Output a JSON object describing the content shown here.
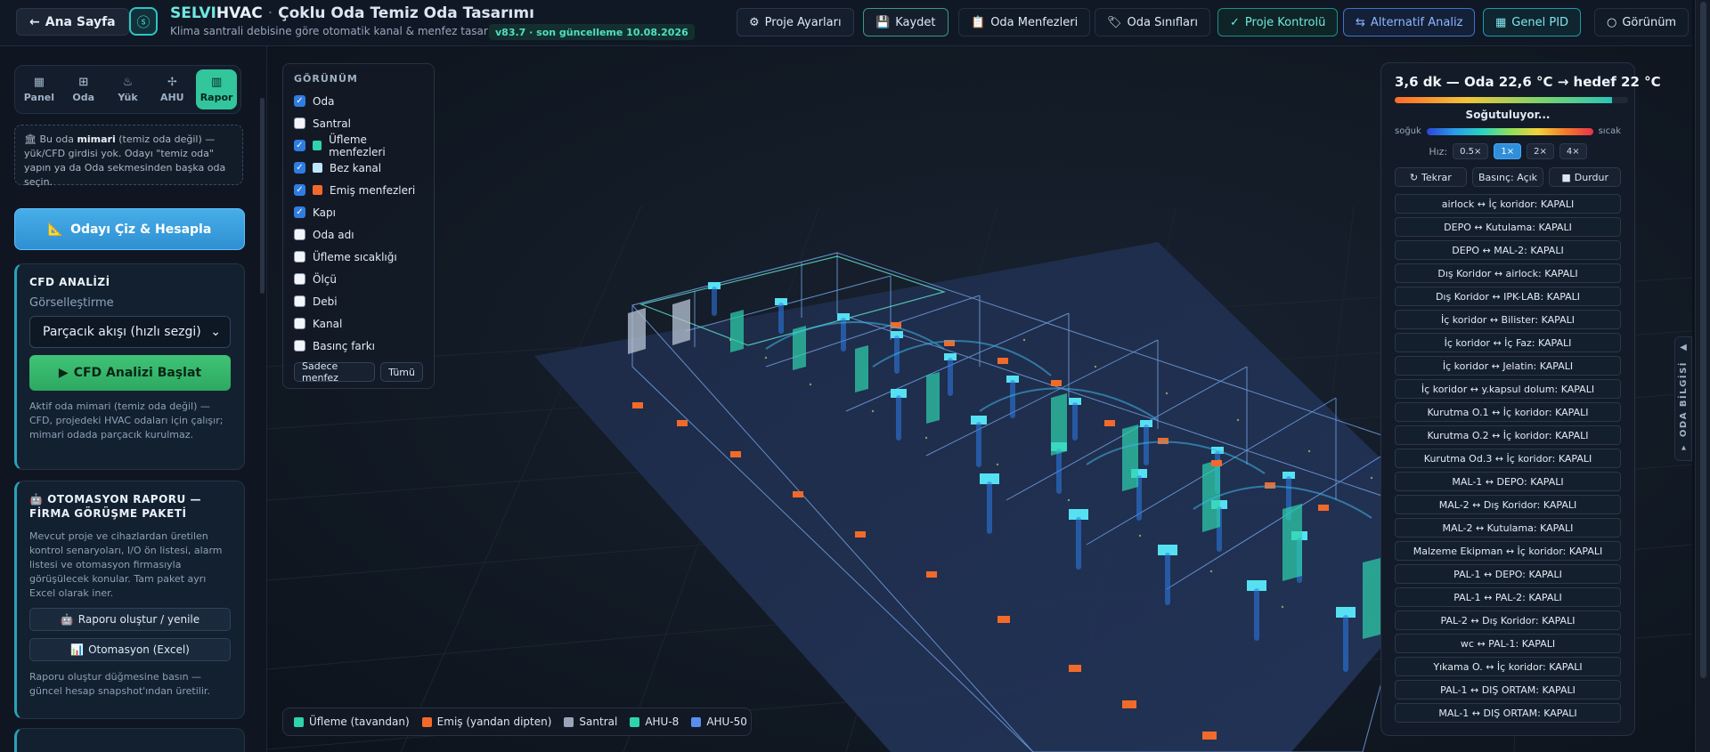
{
  "header": {
    "back_label": "Ana Sayfa",
    "logo_glyph": "ⓢ",
    "brand_part1": "SELVI",
    "brand_part2": "HVAC",
    "brand_sep": "·",
    "title": "Çoklu Oda Temiz Oda Tasarımı",
    "subtitle": "Klima santrali debisine göre otomatik kanal & menfez tasarımı",
    "version": "v83.7 · son güncelleme 10.08.2026",
    "buttons": {
      "project_settings": "Proje Ayarları",
      "save": "Kaydet",
      "room_vents": "Oda Menfezleri",
      "room_classes": "Oda Sınıfları",
      "project_check": "Proje Kontrolü",
      "alt_analysis": "Alternatif Analiz",
      "general_pid": "Genel PID",
      "view": "Görünüm"
    }
  },
  "sidebar": {
    "tabs": [
      {
        "label": "Panel",
        "icon": "grid-icon"
      },
      {
        "label": "Oda",
        "icon": "room-icon"
      },
      {
        "label": "Yük",
        "icon": "flame-icon"
      },
      {
        "label": "AHU",
        "icon": "fan-icon"
      },
      {
        "label": "Rapor",
        "icon": "chart-icon"
      }
    ],
    "note_prefix": "Bu oda ",
    "note_bold": "mimari",
    "note_rest": " (temiz oda değil) — yük/CFD girdisi yok. Odayı \"temiz oda\" yapın ya da Oda sekmesinden başka oda seçin.",
    "draw_button": "Odayı Çiz & Hesapla",
    "cfd": {
      "title": "CFD ANALİZİ",
      "viz_label": "Görselleştirme",
      "viz_selected": "Parçacık akışı (hızlı sezgi)",
      "start_button": "CFD Analizi Başlat",
      "desc": "Aktif oda mimari (temiz oda değil) — CFD, projedeki HVAC odaları için çalışır; mimari odada parçacık kurulmaz."
    },
    "automation": {
      "title": "OTOMASYON RAPORU — FİRMA GÖRÜŞME PAKETİ",
      "desc": "Mevcut proje ve cihazlardan üretilen kontrol senaryoları, I/O ön listesi, alarm listesi ve otomasyon firmasıyla görüşülecek konular. Tam paket ayrı Excel olarak iner.",
      "generate_button": "Raporu oluştur / yenile",
      "excel_button": "Otomasyon (Excel)",
      "footer": "Raporu oluştur düğmesine basın — güncel hesap snapshot'ından üretilir."
    }
  },
  "view_panel": {
    "title": "GÖRÜNÜM",
    "items": [
      {
        "label": "Oda",
        "checked": true,
        "swatch": ""
      },
      {
        "label": "Santral",
        "checked": false,
        "swatch": ""
      },
      {
        "label": "Üfleme menfezleri",
        "checked": true,
        "swatch": "#2fd3ad"
      },
      {
        "label": "Bez kanal",
        "checked": true,
        "swatch": "#bfe6ff"
      },
      {
        "label": "Emiş menfezleri",
        "checked": true,
        "swatch": "#f26a2a"
      },
      {
        "label": "Kapı",
        "checked": true,
        "swatch": ""
      },
      {
        "label": "Oda adı",
        "checked": false,
        "swatch": ""
      },
      {
        "label": "Üfleme sıcaklığı",
        "checked": false,
        "swatch": ""
      },
      {
        "label": "Ölçü",
        "checked": false,
        "swatch": ""
      },
      {
        "label": "Debi",
        "checked": false,
        "swatch": ""
      },
      {
        "label": "Kanal",
        "checked": false,
        "swatch": ""
      },
      {
        "label": "Basınç farkı",
        "checked": false,
        "swatch": ""
      }
    ],
    "only_vents": "Sadece menfez",
    "all": "Tümü"
  },
  "legend": [
    {
      "label": "Üfleme (tavandan)",
      "color": "#2fd3ad"
    },
    {
      "label": "Emiş (yandan dipten)",
      "color": "#f26a2a"
    },
    {
      "label": "Santral",
      "color": "#9aa6b8"
    },
    {
      "label": "AHU-8",
      "color": "#2fd3ad"
    },
    {
      "label": "AHU-50",
      "color": "#5b8df0"
    }
  ],
  "sim_panel": {
    "headline": "3,6 dk — Oda 22,6 °C → hedef 22 °C",
    "progress": 0.93,
    "status": "Soğutuluyor...",
    "cold_label": "soğuk",
    "hot_label": "sıcak",
    "speed_label": "Hız:",
    "speeds": [
      "0.5×",
      "1×",
      "2×",
      "4×"
    ],
    "active_speed": 1,
    "replay": "Tekrar",
    "pressure": "Basınç: Açık",
    "stop": "Durdur",
    "door_pairs": [
      "airlock ↔ İç koridor: KAPALI",
      "DEPO ↔ Kutulama: KAPALI",
      "DEPO ↔ MAL-2: KAPALI",
      "Dış Koridor ↔ airlock: KAPALI",
      "Dış Koridor ↔ IPK-LAB: KAPALI",
      "İç koridor ↔ Bilister: KAPALI",
      "İç koridor ↔ İç Faz: KAPALI",
      "İç koridor ↔ Jelatin: KAPALI",
      "İç koridor ↔ y.kapsul dolum: KAPALI",
      "Kurutma O.1 ↔ İç koridor: KAPALI",
      "Kurutma O.2 ↔ İç koridor: KAPALI",
      "Kurutma Od.3 ↔ İç koridor: KAPALI",
      "MAL-1 ↔ DEPO: KAPALI",
      "MAL-2 ↔ Dış Koridor: KAPALI",
      "MAL-2 ↔ Kutulama: KAPALI",
      "Malzeme Ekipman ↔ İç koridor: KAPALI",
      "PAL-1 ↔ DEPO: KAPALI",
      "PAL-1 ↔ PAL-2: KAPALI",
      "PAL-2 ↔ Dış Koridor: KAPALI",
      "wc ↔ PAL-1: KAPALI",
      "Yıkama O. ↔ İç koridor: KAPALI",
      "PAL-1 ↔ DIŞ ORTAM: KAPALI",
      "MAL-1 ↔ DIŞ ORTAM: KAPALI"
    ]
  },
  "side_tab": {
    "label": "▾ ODA BİLGİSİ",
    "arrow": "◀"
  }
}
